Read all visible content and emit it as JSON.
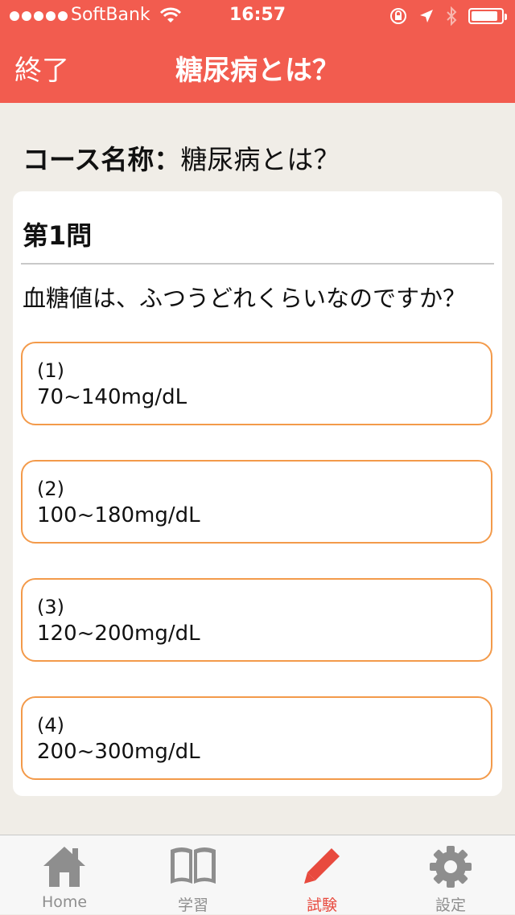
{
  "status_bar": {
    "carrier": "SoftBank",
    "time": "16:57",
    "battery_level": 0.9
  },
  "nav": {
    "left_button": "終了",
    "title": "糖尿病とは？"
  },
  "course": {
    "label": "コース名称：",
    "name": "糖尿病とは？"
  },
  "question": {
    "number": "第1問",
    "text": "血糖値は、ふつうどれくらいなのですか？",
    "choices": [
      {
        "num": "(1)",
        "value": "70~140mg/dL"
      },
      {
        "num": "(2)",
        "value": "100~180mg/dL"
      },
      {
        "num": "(3)",
        "value": "120~200mg/dL"
      },
      {
        "num": "(4)",
        "value": "200~300mg/dL"
      }
    ]
  },
  "tabs": [
    {
      "label": "Home",
      "icon": "home-icon",
      "active": false
    },
    {
      "label": "学習",
      "icon": "book-icon",
      "active": false
    },
    {
      "label": "試験",
      "icon": "pencil-icon",
      "active": true
    },
    {
      "label": "設定",
      "icon": "gear-icon",
      "active": false
    }
  ],
  "colors": {
    "header": "#f25c4f",
    "background": "#f0ede7",
    "choice_border": "#f39a4a",
    "active_tab": "#e84a3e",
    "inactive_tab": "#8e8e8e"
  }
}
